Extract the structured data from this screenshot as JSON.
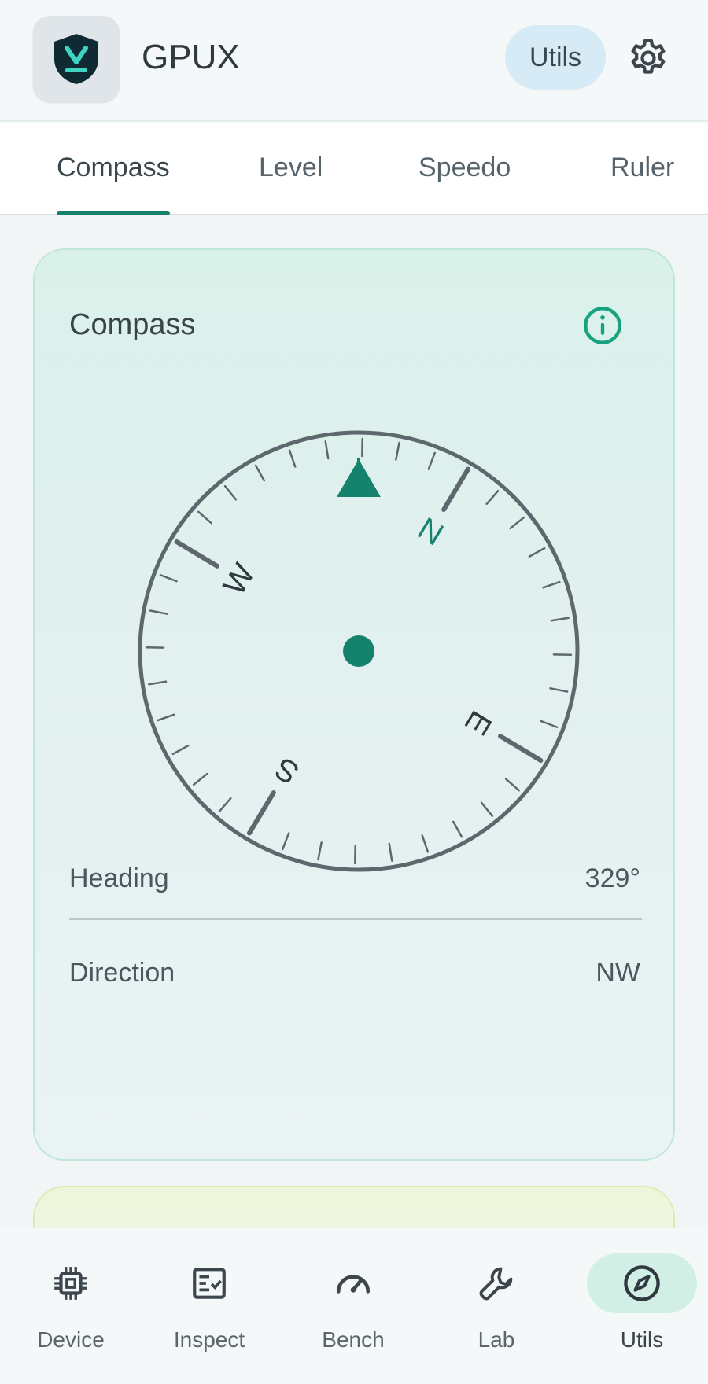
{
  "header": {
    "app_title": "GPUX",
    "utils_chip": "Utils",
    "app_icon": "shield-v-logo-icon",
    "settings_icon": "gear-icon"
  },
  "tabs": [
    {
      "label": "Compass",
      "active": true
    },
    {
      "label": "Level",
      "active": false
    },
    {
      "label": "Speedo",
      "active": false
    },
    {
      "label": "Ruler",
      "active": false
    }
  ],
  "compass_card": {
    "title": "Compass",
    "info_icon": "info-icon",
    "heading_deg": 329,
    "cardinals": [
      "N",
      "E",
      "S",
      "W"
    ],
    "rows": [
      {
        "label": "Heading",
        "value": "329°"
      },
      {
        "label": "Direction",
        "value": "NW"
      }
    ]
  },
  "bottom_nav": [
    {
      "label": "Device",
      "icon": "chip-icon",
      "active": false
    },
    {
      "label": "Inspect",
      "icon": "checklist-icon",
      "active": false
    },
    {
      "label": "Bench",
      "icon": "speedometer-icon",
      "active": false
    },
    {
      "label": "Lab",
      "icon": "wrench-icon",
      "active": false
    },
    {
      "label": "Utils",
      "icon": "compass-icon",
      "active": true
    }
  ],
  "colors": {
    "accent": "#15826e",
    "dial_stroke": "#5e676e",
    "chip_bg": "#d6ebf6",
    "nav_active_bg": "#d2efe6"
  }
}
